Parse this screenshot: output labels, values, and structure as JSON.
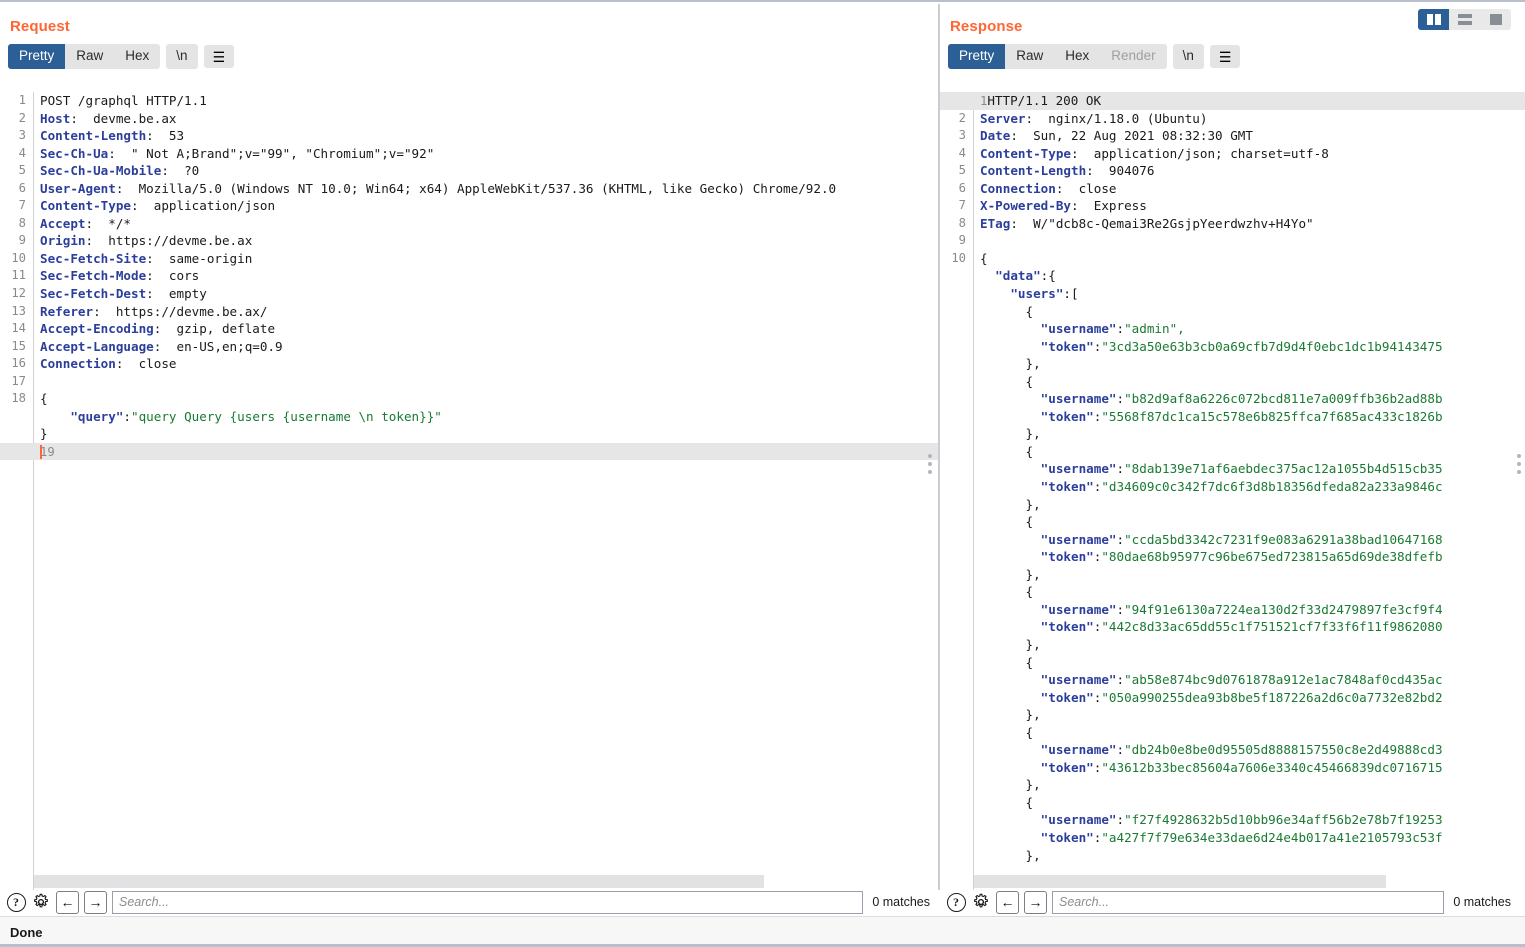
{
  "layout_toggles": [
    {
      "name": "split-view",
      "active": true
    },
    {
      "name": "stacked-view",
      "active": false
    },
    {
      "name": "single-view",
      "active": false
    }
  ],
  "request": {
    "title": "Request",
    "tabs": [
      {
        "label": "Pretty",
        "active": true,
        "disabled": false
      },
      {
        "label": "Raw",
        "active": false,
        "disabled": false
      },
      {
        "label": "Hex",
        "active": false,
        "disabled": false
      }
    ],
    "newline_button": "\\n",
    "menu_icon": "hamburger-icon",
    "search": {
      "placeholder": "Search...",
      "value": "",
      "matches": "0 matches",
      "help_icon": "?",
      "settings_icon": "gear-icon",
      "prev_icon": "←",
      "next_icon": "→"
    },
    "lines": [
      {
        "n": 1,
        "segments": [
          {
            "t": "POST /graphql HTTP/1.1",
            "c": "v"
          }
        ]
      },
      {
        "n": 2,
        "segments": [
          {
            "t": "Host",
            "c": "k"
          },
          {
            "t": ":  devme.be.ax",
            "c": "v"
          }
        ]
      },
      {
        "n": 3,
        "segments": [
          {
            "t": "Content-Length",
            "c": "k"
          },
          {
            "t": ":  53",
            "c": "v"
          }
        ]
      },
      {
        "n": 4,
        "segments": [
          {
            "t": "Sec-Ch-Ua",
            "c": "k"
          },
          {
            "t": ":  \" Not A;Brand\";v=\"99\", \"Chromium\";v=\"92\"",
            "c": "v"
          }
        ]
      },
      {
        "n": 5,
        "segments": [
          {
            "t": "Sec-Ch-Ua-Mobile",
            "c": "k"
          },
          {
            "t": ":  ?0",
            "c": "v"
          }
        ]
      },
      {
        "n": 6,
        "segments": [
          {
            "t": "User-Agent",
            "c": "k"
          },
          {
            "t": ":  Mozilla/5.0 (Windows NT 10.0; Win64; x64) AppleWebKit/537.36 (KHTML, like Gecko) Chrome/92.0",
            "c": "v"
          }
        ]
      },
      {
        "n": 7,
        "segments": [
          {
            "t": "Content-Type",
            "c": "k"
          },
          {
            "t": ":  application/json",
            "c": "v"
          }
        ]
      },
      {
        "n": 8,
        "segments": [
          {
            "t": "Accept",
            "c": "k"
          },
          {
            "t": ":  */*",
            "c": "v"
          }
        ]
      },
      {
        "n": 9,
        "segments": [
          {
            "t": "Origin",
            "c": "k"
          },
          {
            "t": ":  https://devme.be.ax",
            "c": "v"
          }
        ]
      },
      {
        "n": 10,
        "segments": [
          {
            "t": "Sec-Fetch-Site",
            "c": "k"
          },
          {
            "t": ":  same-origin",
            "c": "v"
          }
        ]
      },
      {
        "n": 11,
        "segments": [
          {
            "t": "Sec-Fetch-Mode",
            "c": "k"
          },
          {
            "t": ":  cors",
            "c": "v"
          }
        ]
      },
      {
        "n": 12,
        "segments": [
          {
            "t": "Sec-Fetch-Dest",
            "c": "k"
          },
          {
            "t": ":  empty",
            "c": "v"
          }
        ]
      },
      {
        "n": 13,
        "segments": [
          {
            "t": "Referer",
            "c": "k"
          },
          {
            "t": ":  https://devme.be.ax/",
            "c": "v"
          }
        ]
      },
      {
        "n": 14,
        "segments": [
          {
            "t": "Accept-Encoding",
            "c": "k"
          },
          {
            "t": ":  gzip, deflate",
            "c": "v"
          }
        ]
      },
      {
        "n": 15,
        "segments": [
          {
            "t": "Accept-Language",
            "c": "k"
          },
          {
            "t": ":  en-US,en;q=0.9",
            "c": "v"
          }
        ]
      },
      {
        "n": 16,
        "segments": [
          {
            "t": "Connection",
            "c": "k"
          },
          {
            "t": ":  close",
            "c": "v"
          }
        ]
      },
      {
        "n": 17,
        "segments": []
      },
      {
        "n": 18,
        "segments": [
          {
            "t": "{",
            "c": "p"
          }
        ]
      },
      {
        "n": "",
        "segments": [
          {
            "t": "    ",
            "c": "p"
          },
          {
            "t": "\"query\"",
            "c": "k"
          },
          {
            "t": ":",
            "c": "p"
          },
          {
            "t": "\"query Query {users {username \\n token}}\"",
            "c": "s"
          }
        ]
      },
      {
        "n": "",
        "segments": [
          {
            "t": "}",
            "c": "p"
          }
        ]
      },
      {
        "n": 19,
        "segments": [],
        "highlight": true,
        "caret": true
      }
    ]
  },
  "response": {
    "title": "Response",
    "tabs": [
      {
        "label": "Pretty",
        "active": true,
        "disabled": false
      },
      {
        "label": "Raw",
        "active": false,
        "disabled": false
      },
      {
        "label": "Hex",
        "active": false,
        "disabled": false
      },
      {
        "label": "Render",
        "active": false,
        "disabled": true
      }
    ],
    "newline_button": "\\n",
    "menu_icon": "hamburger-icon",
    "search": {
      "placeholder": "Search...",
      "value": "",
      "matches": "0 matches",
      "help_icon": "?",
      "settings_icon": "gear-icon",
      "prev_icon": "←",
      "next_icon": "→"
    },
    "lines": [
      {
        "n": 1,
        "segments": [
          {
            "t": "HTTP/1.1 200 OK",
            "c": "v"
          }
        ],
        "highlight": true
      },
      {
        "n": 2,
        "segments": [
          {
            "t": "Server",
            "c": "k"
          },
          {
            "t": ":  nginx/1.18.0 (Ubuntu)",
            "c": "v"
          }
        ]
      },
      {
        "n": 3,
        "segments": [
          {
            "t": "Date",
            "c": "k"
          },
          {
            "t": ":  Sun, 22 Aug 2021 08:32:30 GMT",
            "c": "v"
          }
        ]
      },
      {
        "n": 4,
        "segments": [
          {
            "t": "Content-Type",
            "c": "k"
          },
          {
            "t": ":  application/json; charset=utf-8",
            "c": "v"
          }
        ]
      },
      {
        "n": 5,
        "segments": [
          {
            "t": "Content-Length",
            "c": "k"
          },
          {
            "t": ":  904076",
            "c": "v"
          }
        ]
      },
      {
        "n": 6,
        "segments": [
          {
            "t": "Connection",
            "c": "k"
          },
          {
            "t": ":  close",
            "c": "v"
          }
        ]
      },
      {
        "n": 7,
        "segments": [
          {
            "t": "X-Powered-By",
            "c": "k"
          },
          {
            "t": ":  Express",
            "c": "v"
          }
        ]
      },
      {
        "n": 8,
        "segments": [
          {
            "t": "ETag",
            "c": "k"
          },
          {
            "t": ":  W/\"dcb8c-Qemai3Re2GsjpYeerdwzhv+H4Yo\"",
            "c": "v"
          }
        ]
      },
      {
        "n": 9,
        "segments": []
      },
      {
        "n": 10,
        "segments": [
          {
            "t": "{",
            "c": "p"
          }
        ]
      },
      {
        "n": "",
        "segments": [
          {
            "t": "  ",
            "c": "p"
          },
          {
            "t": "\"data\"",
            "c": "k"
          },
          {
            "t": ":{",
            "c": "p"
          }
        ]
      },
      {
        "n": "",
        "segments": [
          {
            "t": "    ",
            "c": "p"
          },
          {
            "t": "\"users\"",
            "c": "k"
          },
          {
            "t": ":[",
            "c": "p"
          }
        ]
      },
      {
        "n": "",
        "segments": [
          {
            "t": "      {",
            "c": "p"
          }
        ]
      },
      {
        "n": "",
        "segments": [
          {
            "t": "        ",
            "c": "p"
          },
          {
            "t": "\"username\"",
            "c": "k"
          },
          {
            "t": ":",
            "c": "p"
          },
          {
            "t": "\"admin\",",
            "c": "s"
          }
        ]
      },
      {
        "n": "",
        "segments": [
          {
            "t": "        ",
            "c": "p"
          },
          {
            "t": "\"token\"",
            "c": "k"
          },
          {
            "t": ":",
            "c": "p"
          },
          {
            "t": "\"3cd3a50e63b3cb0a69cfb7d9d4f0ebc1dc1b94143475",
            "c": "s"
          }
        ]
      },
      {
        "n": "",
        "segments": [
          {
            "t": "      },",
            "c": "p"
          }
        ]
      },
      {
        "n": "",
        "segments": [
          {
            "t": "      {",
            "c": "p"
          }
        ]
      },
      {
        "n": "",
        "segments": [
          {
            "t": "        ",
            "c": "p"
          },
          {
            "t": "\"username\"",
            "c": "k"
          },
          {
            "t": ":",
            "c": "p"
          },
          {
            "t": "\"b82d9af8a6226c072bcd811e7a009ffb36b2ad88b",
            "c": "s"
          }
        ]
      },
      {
        "n": "",
        "segments": [
          {
            "t": "        ",
            "c": "p"
          },
          {
            "t": "\"token\"",
            "c": "k"
          },
          {
            "t": ":",
            "c": "p"
          },
          {
            "t": "\"5568f87dc1ca15c578e6b825ffca7f685ac433c1826b",
            "c": "s"
          }
        ]
      },
      {
        "n": "",
        "segments": [
          {
            "t": "      },",
            "c": "p"
          }
        ]
      },
      {
        "n": "",
        "segments": [
          {
            "t": "      {",
            "c": "p"
          }
        ]
      },
      {
        "n": "",
        "segments": [
          {
            "t": "        ",
            "c": "p"
          },
          {
            "t": "\"username\"",
            "c": "k"
          },
          {
            "t": ":",
            "c": "p"
          },
          {
            "t": "\"8dab139e71af6aebdec375ac12a1055b4d515cb35",
            "c": "s"
          }
        ]
      },
      {
        "n": "",
        "segments": [
          {
            "t": "        ",
            "c": "p"
          },
          {
            "t": "\"token\"",
            "c": "k"
          },
          {
            "t": ":",
            "c": "p"
          },
          {
            "t": "\"d34609c0c342f7dc6f3d8b18356dfeda82a233a9846c",
            "c": "s"
          }
        ]
      },
      {
        "n": "",
        "segments": [
          {
            "t": "      },",
            "c": "p"
          }
        ]
      },
      {
        "n": "",
        "segments": [
          {
            "t": "      {",
            "c": "p"
          }
        ]
      },
      {
        "n": "",
        "segments": [
          {
            "t": "        ",
            "c": "p"
          },
          {
            "t": "\"username\"",
            "c": "k"
          },
          {
            "t": ":",
            "c": "p"
          },
          {
            "t": "\"ccda5bd3342c7231f9e083a6291a38bad10647168",
            "c": "s"
          }
        ]
      },
      {
        "n": "",
        "segments": [
          {
            "t": "        ",
            "c": "p"
          },
          {
            "t": "\"token\"",
            "c": "k"
          },
          {
            "t": ":",
            "c": "p"
          },
          {
            "t": "\"80dae68b95977c96be675ed723815a65d69de38dfefb",
            "c": "s"
          }
        ]
      },
      {
        "n": "",
        "segments": [
          {
            "t": "      },",
            "c": "p"
          }
        ]
      },
      {
        "n": "",
        "segments": [
          {
            "t": "      {",
            "c": "p"
          }
        ]
      },
      {
        "n": "",
        "segments": [
          {
            "t": "        ",
            "c": "p"
          },
          {
            "t": "\"username\"",
            "c": "k"
          },
          {
            "t": ":",
            "c": "p"
          },
          {
            "t": "\"94f91e6130a7224ea130d2f33d2479897fe3cf9f4",
            "c": "s"
          }
        ]
      },
      {
        "n": "",
        "segments": [
          {
            "t": "        ",
            "c": "p"
          },
          {
            "t": "\"token\"",
            "c": "k"
          },
          {
            "t": ":",
            "c": "p"
          },
          {
            "t": "\"442c8d33ac65dd55c1f751521cf7f33f6f11f9862080",
            "c": "s"
          }
        ]
      },
      {
        "n": "",
        "segments": [
          {
            "t": "      },",
            "c": "p"
          }
        ]
      },
      {
        "n": "",
        "segments": [
          {
            "t": "      {",
            "c": "p"
          }
        ]
      },
      {
        "n": "",
        "segments": [
          {
            "t": "        ",
            "c": "p"
          },
          {
            "t": "\"username\"",
            "c": "k"
          },
          {
            "t": ":",
            "c": "p"
          },
          {
            "t": "\"ab58e874bc9d0761878a912e1ac7848af0cd435ac",
            "c": "s"
          }
        ]
      },
      {
        "n": "",
        "segments": [
          {
            "t": "        ",
            "c": "p"
          },
          {
            "t": "\"token\"",
            "c": "k"
          },
          {
            "t": ":",
            "c": "p"
          },
          {
            "t": "\"050a990255dea93b8be5f187226a2d6c0a7732e82bd2",
            "c": "s"
          }
        ]
      },
      {
        "n": "",
        "segments": [
          {
            "t": "      },",
            "c": "p"
          }
        ]
      },
      {
        "n": "",
        "segments": [
          {
            "t": "      {",
            "c": "p"
          }
        ]
      },
      {
        "n": "",
        "segments": [
          {
            "t": "        ",
            "c": "p"
          },
          {
            "t": "\"username\"",
            "c": "k"
          },
          {
            "t": ":",
            "c": "p"
          },
          {
            "t": "\"db24b0e8be0d95505d8888157550c8e2d49888cd3",
            "c": "s"
          }
        ]
      },
      {
        "n": "",
        "segments": [
          {
            "t": "        ",
            "c": "p"
          },
          {
            "t": "\"token\"",
            "c": "k"
          },
          {
            "t": ":",
            "c": "p"
          },
          {
            "t": "\"43612b33bec85604a7606e3340c45466839dc0716715",
            "c": "s"
          }
        ]
      },
      {
        "n": "",
        "segments": [
          {
            "t": "      },",
            "c": "p"
          }
        ]
      },
      {
        "n": "",
        "segments": [
          {
            "t": "      {",
            "c": "p"
          }
        ]
      },
      {
        "n": "",
        "segments": [
          {
            "t": "        ",
            "c": "p"
          },
          {
            "t": "\"username\"",
            "c": "k"
          },
          {
            "t": ":",
            "c": "p"
          },
          {
            "t": "\"f27f4928632b5d10bb96e34aff56b2e78b7f19253",
            "c": "s"
          }
        ]
      },
      {
        "n": "",
        "segments": [
          {
            "t": "        ",
            "c": "p"
          },
          {
            "t": "\"token\"",
            "c": "k"
          },
          {
            "t": ":",
            "c": "p"
          },
          {
            "t": "\"a427f7f79e634e33dae6d24e4b017a41e2105793c53f",
            "c": "s"
          }
        ]
      },
      {
        "n": "",
        "segments": [
          {
            "t": "      },",
            "c": "p"
          }
        ]
      }
    ]
  },
  "status": {
    "text": "Done"
  }
}
